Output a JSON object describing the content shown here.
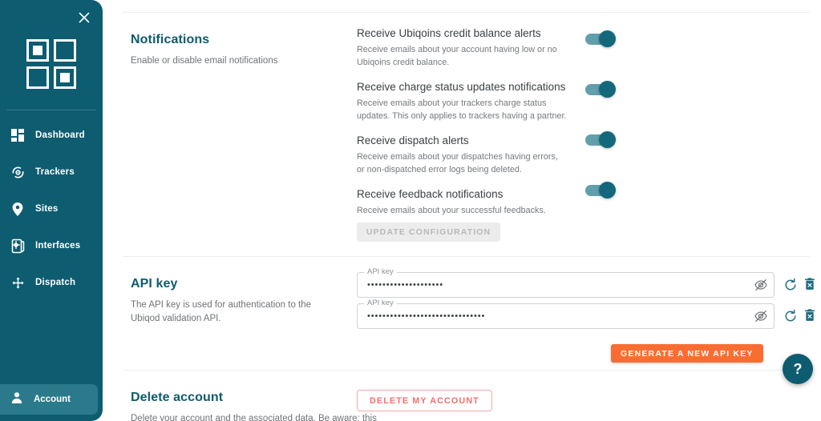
{
  "sidebar": {
    "close_icon": "close-icon",
    "logo_icon": "app-logo-icon",
    "items": [
      {
        "label": "Dashboard",
        "icon": "dashboard-icon"
      },
      {
        "label": "Trackers",
        "icon": "trackers-icon"
      },
      {
        "label": "Sites",
        "icon": "sites-pin-icon"
      },
      {
        "label": "Interfaces",
        "icon": "interfaces-icon"
      },
      {
        "label": "Dispatch",
        "icon": "dispatch-icon"
      }
    ],
    "account": {
      "label": "Account",
      "icon": "person-icon"
    }
  },
  "notifications": {
    "title": "Notifications",
    "description": "Enable or disable email notifications",
    "rows": [
      {
        "name": "Receive Ubiqoins credit balance alerts",
        "sub": "Receive emails about your account having low or no Ubiqoins credit balance.",
        "enabled": true
      },
      {
        "name": "Receive charge status updates notifications",
        "sub": "Receive emails about your trackers charge status updates. This only applies to trackers having a partner.",
        "enabled": true
      },
      {
        "name": "Receive dispatch alerts",
        "sub": "Receive emails about your dispatches having errors, or non-dispatched error logs being deleted.",
        "enabled": true
      },
      {
        "name": "Receive feedback notifications",
        "sub": "Receive emails about your successful feedbacks.",
        "enabled": true
      }
    ],
    "update_button": "UPDATE CONFIGURATION",
    "update_button_disabled": true
  },
  "api_key": {
    "title": "API key",
    "description": "The API key is used for authentication to the Ubiqod validation API.",
    "fields": [
      {
        "legend": "API key",
        "value": "••••••••••••••••••••",
        "eye_icon": "eye-off-icon",
        "refresh_icon": "refresh-icon",
        "delete_icon": "trash-delete-icon"
      },
      {
        "legend": "API key",
        "value": "•••••••••••••••••••••••••••••••",
        "eye_icon": "eye-off-icon",
        "refresh_icon": "refresh-icon",
        "delete_icon": "trash-delete-icon"
      }
    ],
    "generate_button": "GENERATE A NEW API KEY"
  },
  "delete_account": {
    "title": "Delete account",
    "description": "Delete your account and the associated data. Be aware: this",
    "button": "DELETE MY ACCOUNT"
  },
  "help_fab": {
    "label": "?",
    "icon": "help-question-icon"
  },
  "colors": {
    "brand_teal": "#0d5c70",
    "sidebar_active": "#2a7a8c",
    "toggle_track": "#61a0ab",
    "toggle_thumb": "#14687c",
    "accent_orange": "#f96d32",
    "danger_red": "#f2706e",
    "divider": "#ededed"
  }
}
